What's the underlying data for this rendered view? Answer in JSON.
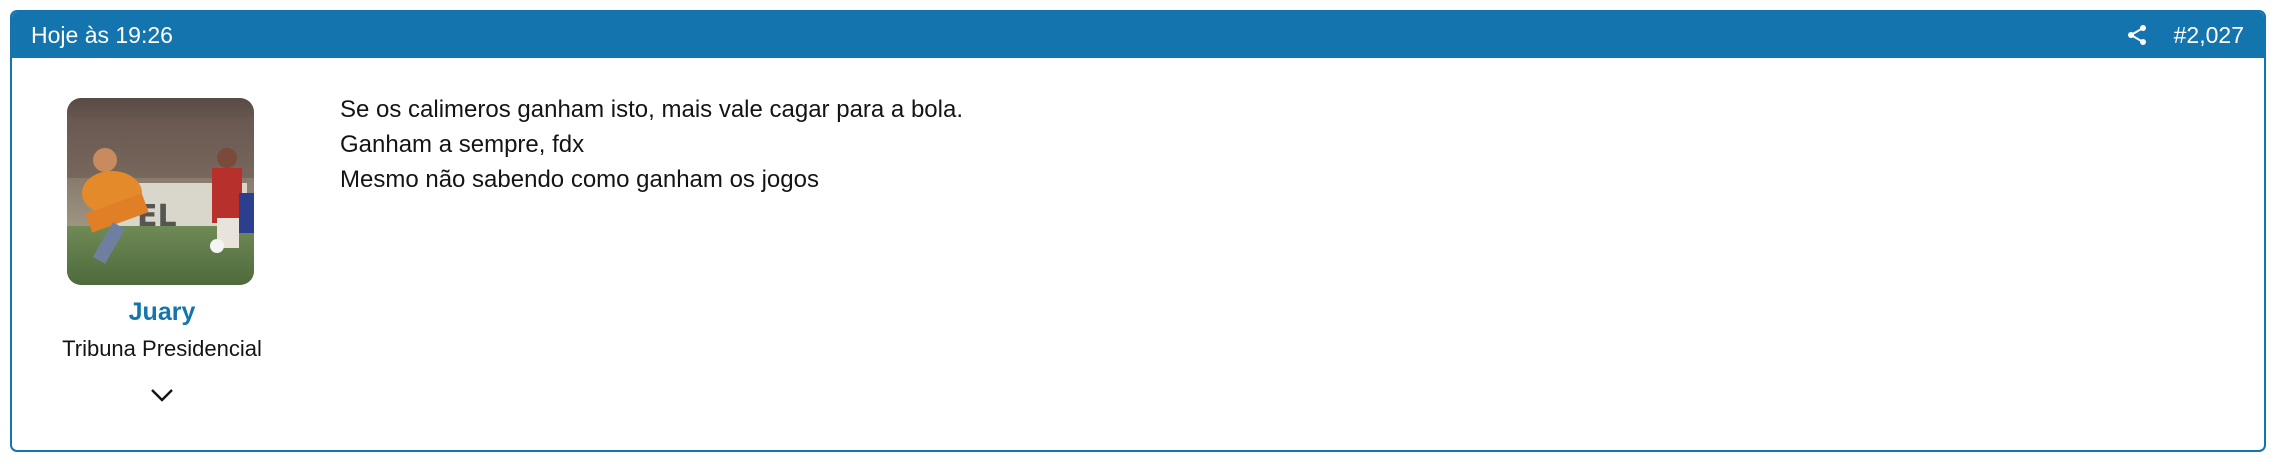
{
  "post": {
    "timestamp": "Hoje às 19:26",
    "share_icon": "share-icon",
    "number": "#2,027",
    "author": {
      "name": "Juary",
      "title": "Tribuna Presidencial",
      "avatar_icon": "avatar-photo",
      "expand_icon": "chevron-down-icon"
    },
    "message_lines": [
      "Se os calimeros ganham isto, mais vale cagar para a bola.",
      "Ganham a sempre, fdx",
      "Mesmo não sabendo como ganham os jogos"
    ]
  },
  "colors": {
    "accent": "#1474ae",
    "text": "#141414",
    "background": "#ffffff"
  }
}
